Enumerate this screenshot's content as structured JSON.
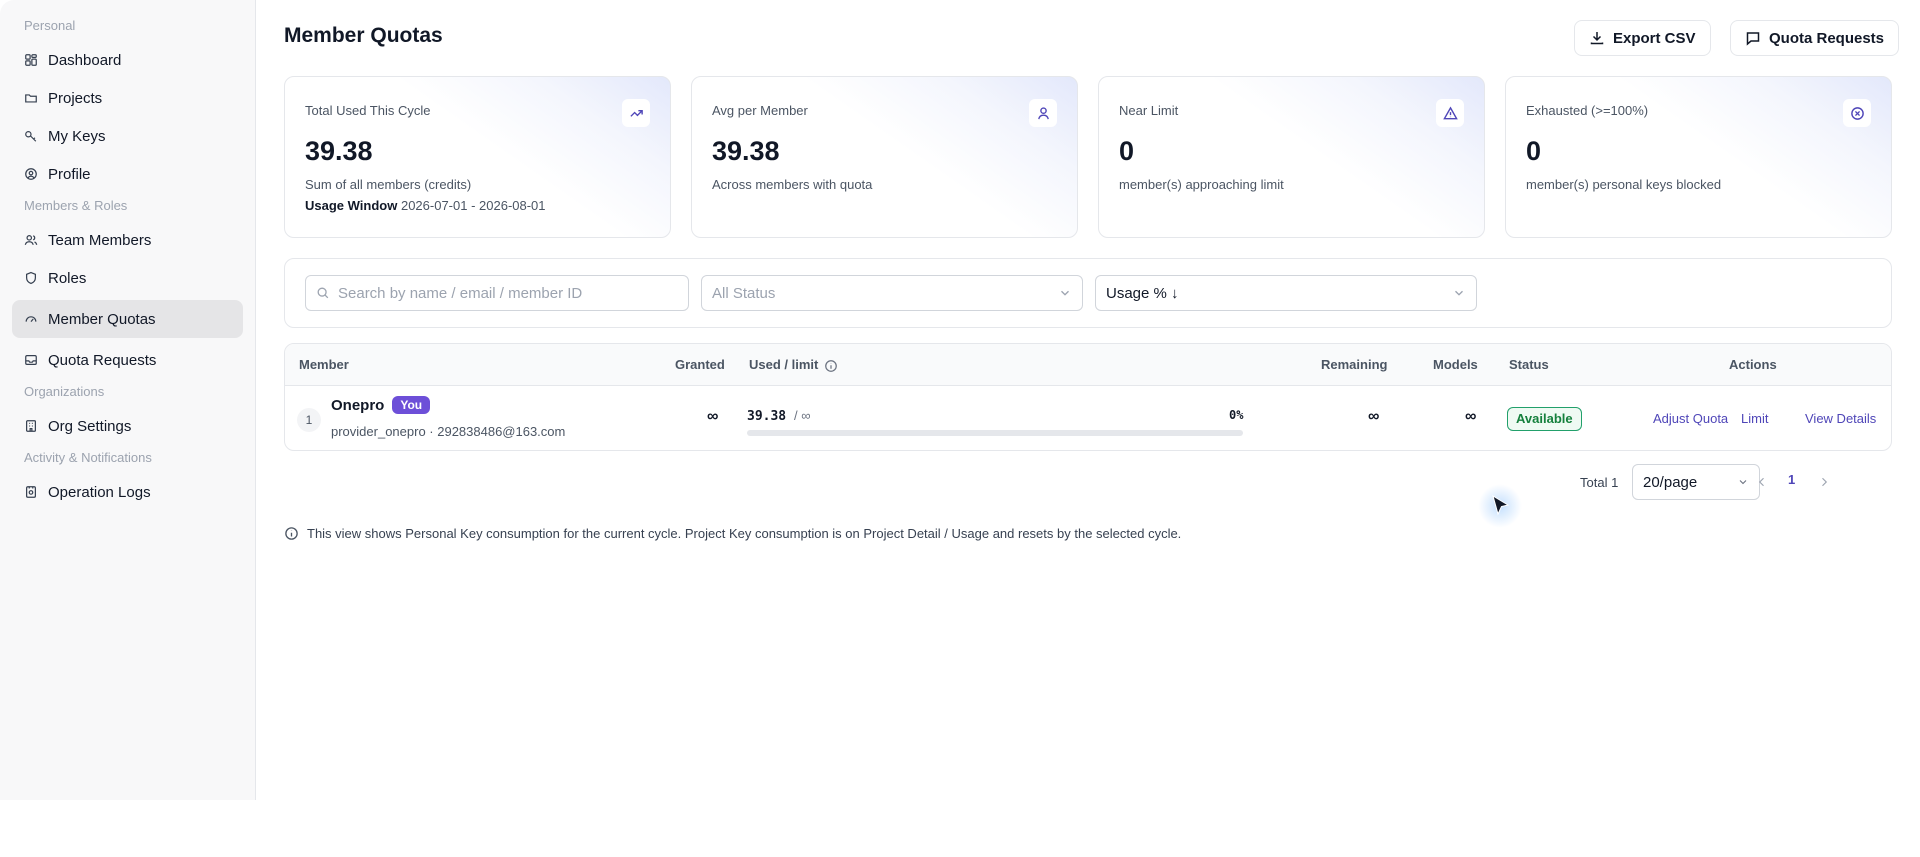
{
  "sidebar": {
    "groups": [
      {
        "label": "Personal"
      },
      {
        "label": "Members & Roles"
      },
      {
        "label": "Organizations"
      },
      {
        "label": "Activity & Notifications"
      }
    ],
    "items": [
      {
        "label": "Dashboard",
        "icon": "dashboard-icon"
      },
      {
        "label": "Projects",
        "icon": "folder-icon"
      },
      {
        "label": "My Keys",
        "icon": "key-icon"
      },
      {
        "label": "Profile",
        "icon": "user-circle-icon"
      },
      {
        "label": "Team Members",
        "icon": "users-icon"
      },
      {
        "label": "Roles",
        "icon": "shield-icon"
      },
      {
        "label": "Member Quotas",
        "icon": "gauge-icon",
        "active": true
      },
      {
        "label": "Quota Requests",
        "icon": "inbox-icon"
      },
      {
        "label": "Org Settings",
        "icon": "building-icon"
      },
      {
        "label": "Operation Logs",
        "icon": "log-icon"
      }
    ]
  },
  "header": {
    "title": "Member Quotas",
    "export_label": "Export CSV",
    "requests_label": "Quota Requests"
  },
  "stats": [
    {
      "label": "Total Used This Cycle",
      "value": "39.38",
      "sub": "Sum of all members (credits)",
      "window_label": "Usage Window",
      "window_value": "2026-07-01 - 2026-08-01",
      "icon": "trend-up-icon"
    },
    {
      "label": "Avg per Member",
      "value": "39.38",
      "sub": "Across members with quota",
      "icon": "user-icon"
    },
    {
      "label": "Near Limit",
      "value": "0",
      "sub": "member(s) approaching limit",
      "icon": "warning-icon"
    },
    {
      "label": "Exhausted (>=100%)",
      "value": "0",
      "sub": "member(s) personal keys blocked",
      "icon": "x-circle-icon"
    }
  ],
  "filters": {
    "search_placeholder": "Search by name / email / member ID",
    "status_value": "All Status",
    "sort_value": "Usage % ↓"
  },
  "table": {
    "columns": [
      "Member",
      "Granted",
      "Used / limit",
      "Remaining",
      "Models",
      "Status",
      "Actions"
    ],
    "rows": [
      {
        "index": "1",
        "name": "Onepro",
        "badge": "You",
        "sub": "provider_onepro · 292838486@163.com",
        "granted": "∞",
        "used": "39.38",
        "limit": "/ ∞",
        "percent_label": "0%",
        "progress": 0,
        "remaining": "∞",
        "models": "∞",
        "status": "Available",
        "actions": [
          "Adjust Quota",
          "Limit",
          "View Details"
        ]
      }
    ]
  },
  "pagination": {
    "total": "Total 1",
    "per_page": "20/page",
    "current": "1"
  },
  "note": "This view shows Personal Key consumption for the current cycle. Project Key consumption is on Project Detail / Usage and resets by the selected cycle.",
  "colors": {
    "accent": "#4f46b8",
    "badge": "#6d4fd8",
    "status_green": "#15803d"
  }
}
